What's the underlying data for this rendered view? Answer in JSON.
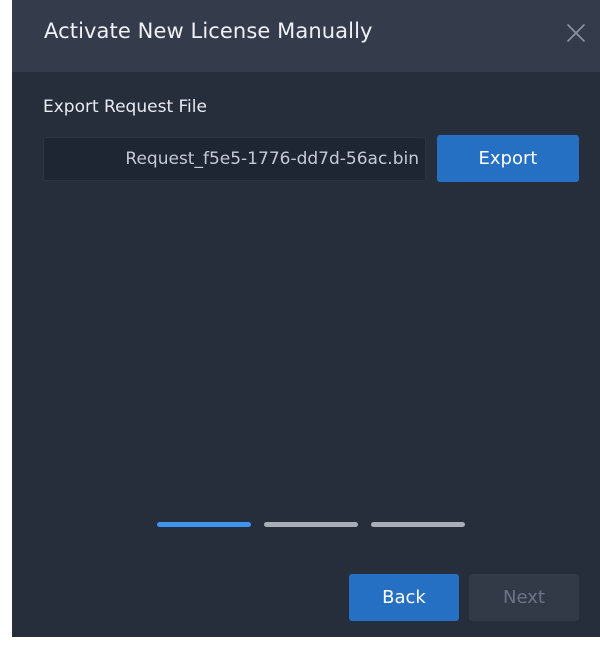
{
  "dialog": {
    "title": "Activate New License Manually",
    "close_icon": "close-icon"
  },
  "export_section": {
    "label": "Export Request File",
    "file_name": "Request_f5e5-1776-dd7d-56ac.bin",
    "export_label": "Export"
  },
  "stepper": {
    "total_steps": 3,
    "current_step": 1,
    "active_color": "#3e95ee",
    "inactive_color": "#a8aeb8"
  },
  "footer": {
    "back_label": "Back",
    "next_label": "Next",
    "next_enabled": false
  },
  "colors": {
    "background": "#262e3c",
    "titlebar": "#343b4a",
    "accent": "#2570c2"
  }
}
